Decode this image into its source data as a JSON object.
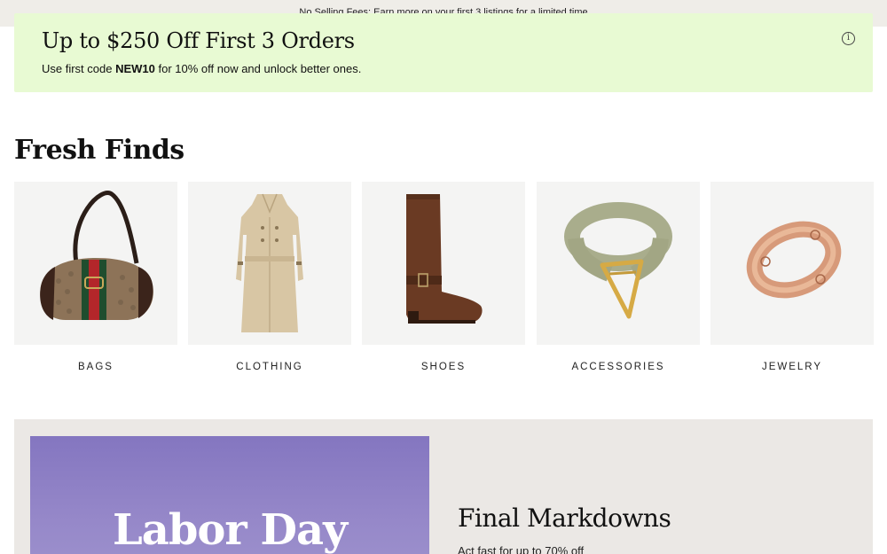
{
  "topbar": {
    "text": "No Selling Fees: Earn more on your first 3 listings for a limited time"
  },
  "promo": {
    "title": "Up to $250 Off First 3 Orders",
    "text_before": "Use first code ",
    "code": "NEW10",
    "text_after": " for 10% off now and unlock better ones.",
    "info_icon": "i"
  },
  "fresh_finds": {
    "title": "Fresh Finds",
    "categories": [
      {
        "label": "BAGS",
        "icon": "handbag-icon"
      },
      {
        "label": "CLOTHING",
        "icon": "trench-coat-icon"
      },
      {
        "label": "SHOES",
        "icon": "boot-icon"
      },
      {
        "label": "ACCESSORIES",
        "icon": "belt-icon"
      },
      {
        "label": "JEWELRY",
        "icon": "ring-icon"
      }
    ]
  },
  "banner": {
    "image_text": "Labor Day",
    "title": "Final Markdowns",
    "subtitle": "Act fast for up to 70% off"
  },
  "colors": {
    "promo_bg": "#e8fad3",
    "banner_bg": "#ebe8e5",
    "banner_img": "#8a7dc4",
    "tile_bg": "#f4f4f3"
  }
}
